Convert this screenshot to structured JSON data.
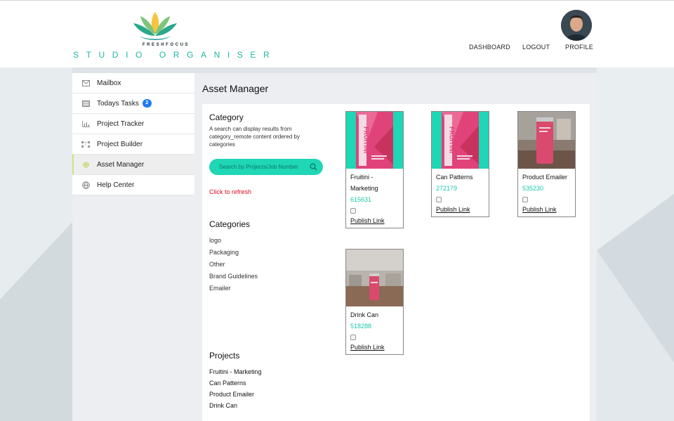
{
  "brand": {
    "small": "FRESHFOCUS",
    "name": "STUDIO ORGANISER",
    "accent": "#20b6a4",
    "logo_colors": [
      "#1c9a8e",
      "#7dc57a",
      "#f5c542"
    ]
  },
  "nav": {
    "dashboard": "DASHBOARD",
    "logout": "LOGOUT",
    "profile": "PROFILE"
  },
  "sidebar": {
    "items": [
      {
        "label": "Mailbox",
        "icon": "mail-icon"
      },
      {
        "label": "Todays Tasks",
        "icon": "tasks-icon",
        "badge": "2"
      },
      {
        "label": "Project Tracker",
        "icon": "chart-icon"
      },
      {
        "label": "Project Builder",
        "icon": "builder-icon"
      },
      {
        "label": "Asset Manager",
        "icon": "gear-icon",
        "active": true
      },
      {
        "label": "Help Center",
        "icon": "globe-icon"
      }
    ]
  },
  "main": {
    "title": "Asset Manager",
    "category_title": "Category",
    "category_desc": "A search can display results from category_remote content ordered by categories",
    "search_placeholder": "Search by Projects/Job Number",
    "refresh": "Click to refresh",
    "categories_title": "Categories",
    "categories": [
      "logo",
      "Packaging",
      "Other",
      "Brand Guidelines",
      "Emailer"
    ],
    "projects_title": "Projects",
    "projects": [
      "Fruitini - Marketing",
      "Can Patterns",
      "Product Emailer",
      "Drink Can"
    ]
  },
  "assets": [
    {
      "title": "Fruitini - Marketing",
      "id": "615631",
      "link": "Publish Link",
      "image": "fruitini-pack"
    },
    {
      "title": "Can Patterns",
      "id": "272179",
      "link": "Publish Link",
      "image": "fruitini-pack"
    },
    {
      "title": "Product Emailer",
      "id": "535230",
      "link": "Publish Link",
      "image": "can-photo"
    },
    {
      "title": "Drink Can",
      "id": "518288",
      "link": "Publish Link",
      "image": "can-table-photo"
    }
  ],
  "packaging_text": "FRUITINI",
  "colors": {
    "teal": "#1fd6b5",
    "pink": "#e0437a",
    "id_text": "#19c9a8",
    "refresh": "#e10f1f",
    "badge": "#1e7cf0"
  }
}
